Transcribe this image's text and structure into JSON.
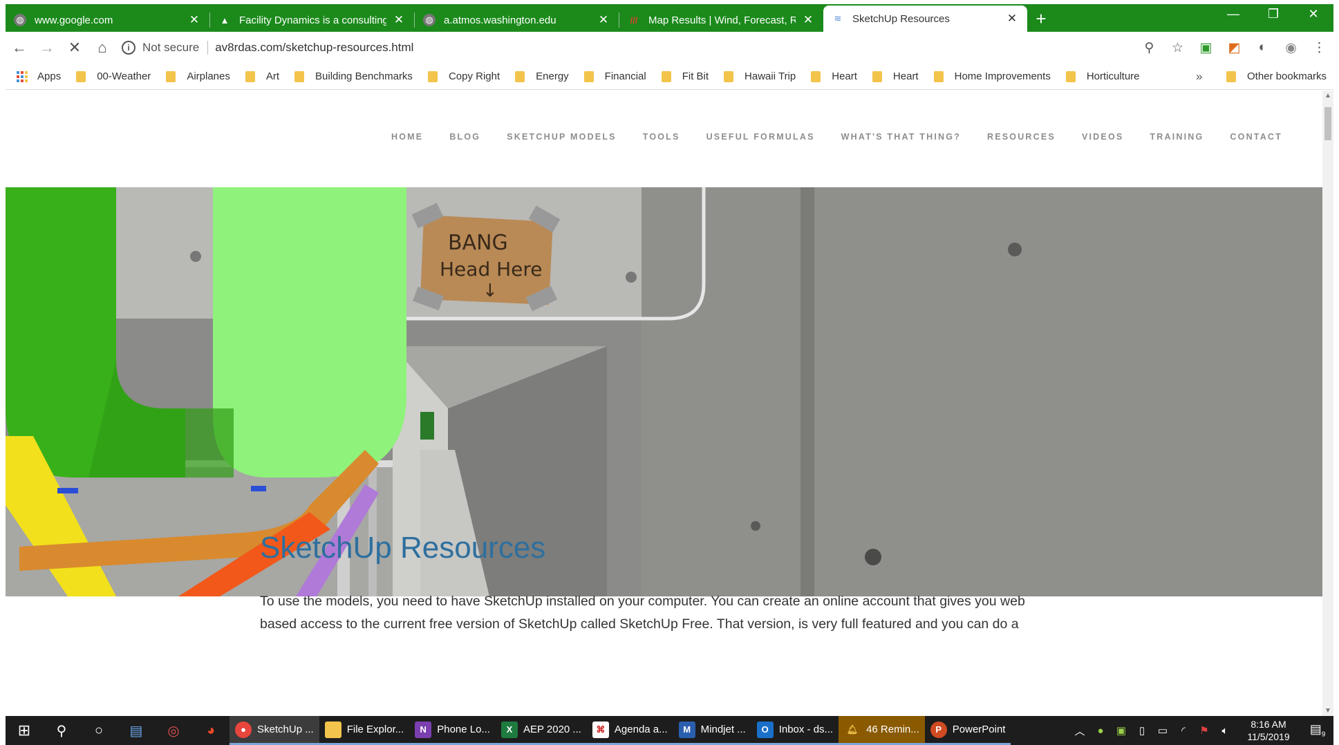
{
  "browser": {
    "tabs": [
      {
        "title": "www.google.com",
        "icon": "globe-icon",
        "active": false
      },
      {
        "title": "Facility Dynamics is a consulting",
        "icon": "facility-dynamics-icon",
        "active": false
      },
      {
        "title": "a.atmos.washington.edu",
        "icon": "globe-icon",
        "active": false
      },
      {
        "title": "Map Results | Wind, Forecast, Ra",
        "icon": "map-results-icon",
        "active": false
      },
      {
        "title": "SketchUp Resources",
        "icon": "sketchup-icon",
        "active": true
      }
    ],
    "new_tab_glyph": "+",
    "address": {
      "security": "Not secure",
      "url": "av8rdas.com/sketchup-resources.html"
    },
    "bookmarks": [
      "Apps",
      "00-Weather",
      "Airplanes",
      "Art",
      "Building Benchmarks",
      "Copy Right",
      "Energy",
      "Financial",
      "Fit Bit",
      "Hawaii Trip",
      "Heart",
      "Heart",
      "Home Improvements",
      "Horticulture"
    ],
    "bookmarks_more": "»",
    "other_bookmarks": "Other bookmarks",
    "theme_color": "#1b8a1b"
  },
  "site": {
    "nav": [
      "HOME",
      "BLOG",
      "SKETCHUP MODELS",
      "TOOLS",
      "USEFUL FORMULAS",
      "WHAT'S THAT THING?",
      "RESOURCES",
      "VIDEOS",
      "TRAINING",
      "CONTACT"
    ],
    "hero_sign_text": [
      "BANG",
      "Head Here"
    ],
    "title": "SketchUp Resources",
    "body_line1": "To use the models, you need to have SketchUp installed on your computer.  You can create an online account that gives you web",
    "body_line2": "based access to the current free version of SketchUp called SketchUp Free.  That version, is very full featured and you can do a",
    "title_color": "#2e6f9e"
  },
  "taskbar": {
    "apps": [
      {
        "label": "SketchUp ...",
        "icon": "chrome-icon",
        "state": "active"
      },
      {
        "label": "File Explor...",
        "icon": "folder-icon",
        "state": "normal"
      },
      {
        "label": "Phone Lo...",
        "icon": "onenote-icon",
        "state": "normal"
      },
      {
        "label": "AEP 2020 ...",
        "icon": "excel-icon",
        "state": "normal"
      },
      {
        "label": "Agenda a...",
        "icon": "pdf-icon",
        "state": "normal"
      },
      {
        "label": "Mindjet ...",
        "icon": "mindjet-icon",
        "state": "normal"
      },
      {
        "label": "Inbox - ds...",
        "icon": "outlook-icon",
        "state": "normal"
      },
      {
        "label": "46 Remin...",
        "icon": "bell-icon",
        "state": "alert"
      },
      {
        "label": "PowerPoint",
        "icon": "powerpoint-icon",
        "state": "normal"
      }
    ],
    "time": "8:16 AM",
    "date": "11/5/2019",
    "notification_count": "9"
  }
}
